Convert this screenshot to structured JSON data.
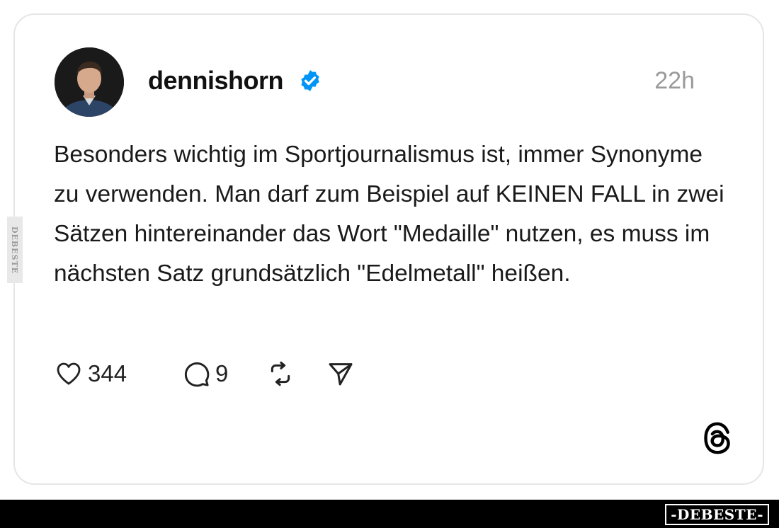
{
  "post": {
    "username": "dennishorn",
    "timestamp": "22h",
    "text": "Besonders wichtig im Sportjournalismus ist, immer Synonyme zu verwenden. Man darf zum Beispiel auf KEINEN FALL in zwei Sätzen hintereinander das Wort \"Medaille\" nutzen, es muss im nächsten Satz grundsätzlich \"Edelmetall\" heißen.",
    "likes_count": "344",
    "replies_count": "9"
  },
  "icons": {
    "verified": "verified-badge-icon",
    "like": "heart-icon",
    "reply": "comment-bubble-icon",
    "repost": "repost-icon",
    "share": "send-icon",
    "platform": "threads-logo-icon"
  },
  "colors": {
    "verified": "#0095f6",
    "card_border": "#e6e6e6",
    "timestamp": "#9a9a9a"
  },
  "watermark": {
    "side": "DEBESTE",
    "bottom": "-DEBESTE-"
  }
}
